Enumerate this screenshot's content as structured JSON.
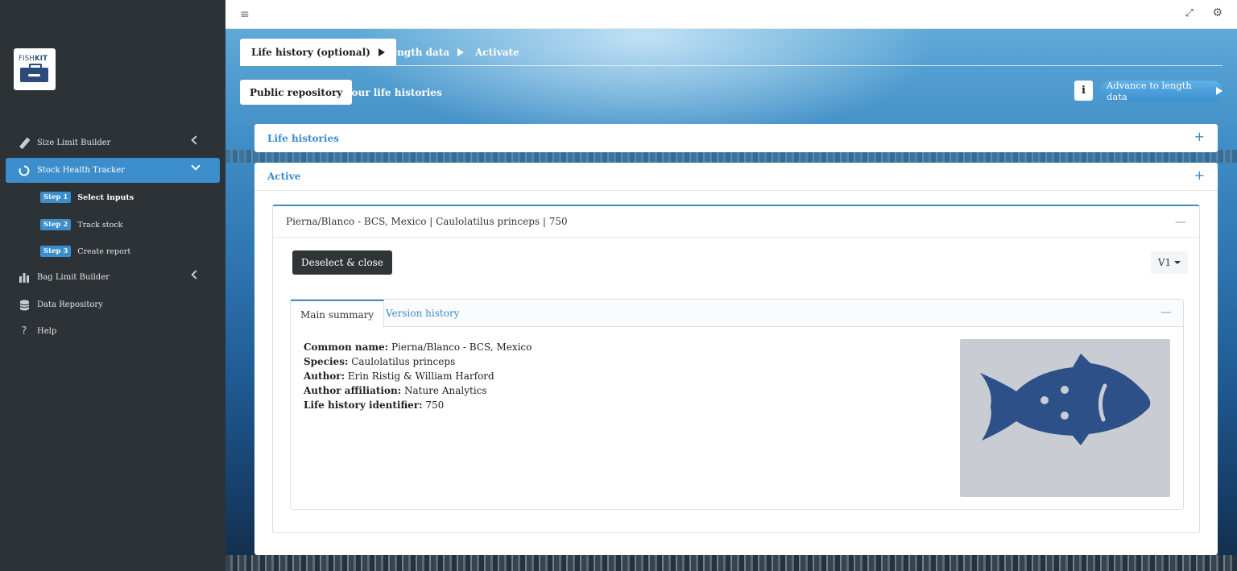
{
  "logo": {
    "text_regular": "FISH",
    "text_bold": "KIT"
  },
  "sidebar": {
    "items": [
      {
        "label": "Size Limit Builder",
        "icon": "ruler-icon"
      },
      {
        "label": "Stock Health Tracker",
        "icon": "circle-notch-icon"
      },
      {
        "label": "Bag Limit Builder",
        "icon": "bar-chart-icon"
      },
      {
        "label": "Data Repository",
        "icon": "database-icon"
      },
      {
        "label": "Help",
        "icon": "question-icon"
      }
    ],
    "steps": [
      {
        "badge": "Step 1",
        "label": "Select inputs"
      },
      {
        "badge": "Step 2",
        "label": "Track stock"
      },
      {
        "badge": "Step 3",
        "label": "Create report"
      }
    ]
  },
  "tabs": {
    "life_history": "Life history (optional)",
    "length_data": "Length data",
    "activate": "Activate"
  },
  "subtabs": {
    "public_repository": "Public repository",
    "your_life_histories": "Your life histories"
  },
  "info_label": "i",
  "advance_label": "Advance to length data",
  "panels": {
    "life_histories": "Life histories",
    "active": "Active"
  },
  "item": {
    "title": "Pierna/Blanco - BCS, Mexico | Caulolatilus princeps | 750",
    "deselect_label": "Deselect & close",
    "version": "V1",
    "tabs": {
      "main_summary": "Main summary",
      "version_history": "Version history"
    },
    "summary": {
      "common_name_label": "Common name:",
      "common_name": "Pierna/Blanco - BCS, Mexico",
      "species_label": "Species:",
      "species": "Caulolatilus princeps",
      "author_label": "Author:",
      "author": "Erin Ristig & William Harford",
      "affiliation_label": "Author affiliation:",
      "affiliation": "Nature Analytics",
      "identifier_label": "Life history identifier:",
      "identifier": "750"
    }
  },
  "colors": {
    "accent": "#3c8dcb",
    "sidebar_bg": "#2d3236",
    "fish": "#2d5088",
    "fish_bg": "#c9ccd3"
  }
}
